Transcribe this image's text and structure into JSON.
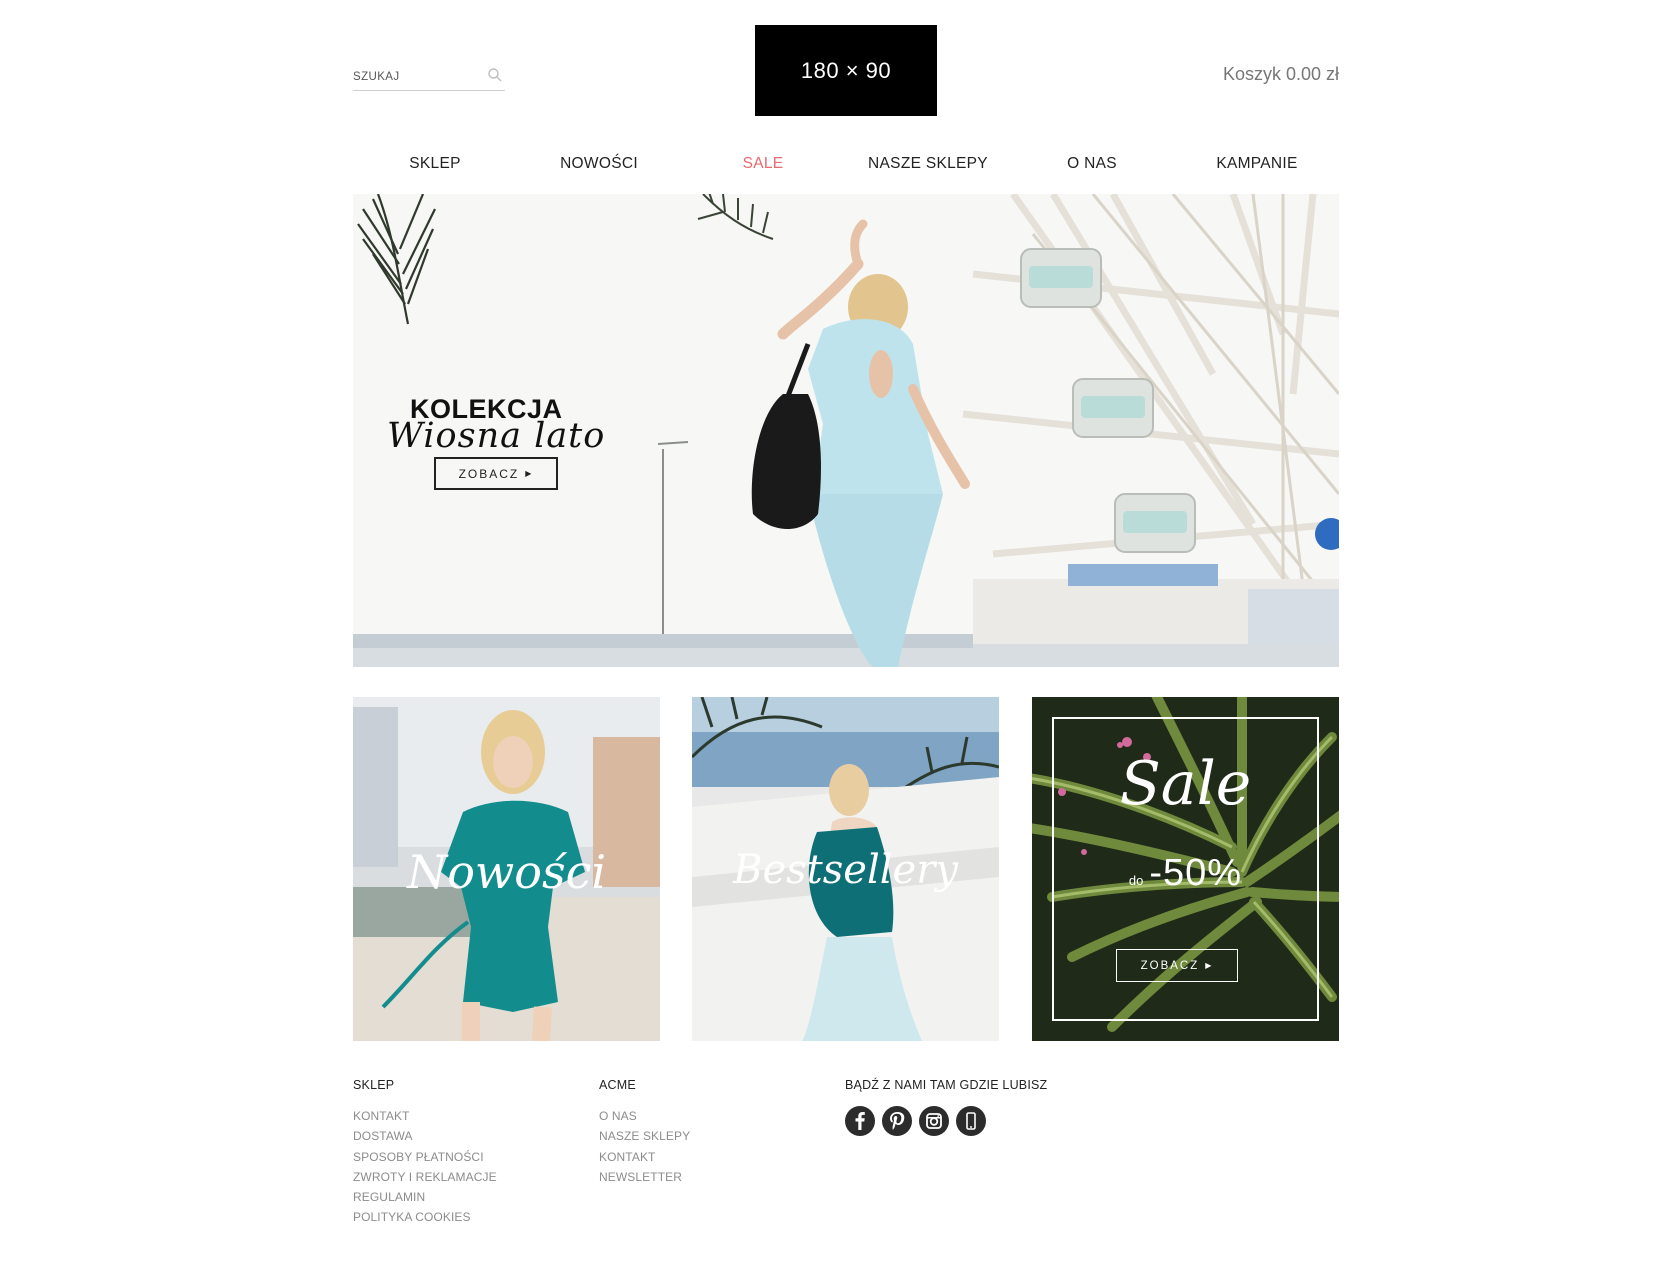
{
  "header": {
    "search_label": "SZUKAJ",
    "logo_text": "180 × 90",
    "cart_label": "Koszyk 0.00 zł"
  },
  "nav": {
    "items": [
      "SKLEP",
      "NOWOŚCI",
      "SALE",
      "NASZE SKLEPY",
      "O NAS",
      "KAMPANIE"
    ],
    "highlight_color": "#e96a6f"
  },
  "hero": {
    "title_bold": "KOLEKCJA",
    "title_script": "Wiosna lato",
    "button_label": "ZOBACZ"
  },
  "tiles": {
    "new": {
      "script": "Nowości"
    },
    "bestsellers": {
      "script": "Bestsellery"
    },
    "sale": {
      "script": "Sale",
      "prefix": "do",
      "discount": "-50%",
      "button_label": "ZOBACZ"
    }
  },
  "footer": {
    "col1": {
      "heading": "SKLEP",
      "links": [
        "KONTAKT",
        "DOSTAWA",
        "SPOSOBY PŁATNOŚCI",
        "ZWROTY I REKLAMACJE",
        "REGULAMIN",
        "POLITYKA COOKIES"
      ]
    },
    "col2": {
      "heading": "ACME",
      "links": [
        "O NAS",
        "NASZE SKLEPY",
        "KONTAKT",
        "NEWSLETTER"
      ]
    },
    "col3": {
      "heading": "BĄDŹ Z NAMI TAM GDZIE LUBISZ",
      "socials": [
        "facebook-icon",
        "pinterest-icon",
        "instagram-icon",
        "mobile-icon"
      ]
    }
  }
}
